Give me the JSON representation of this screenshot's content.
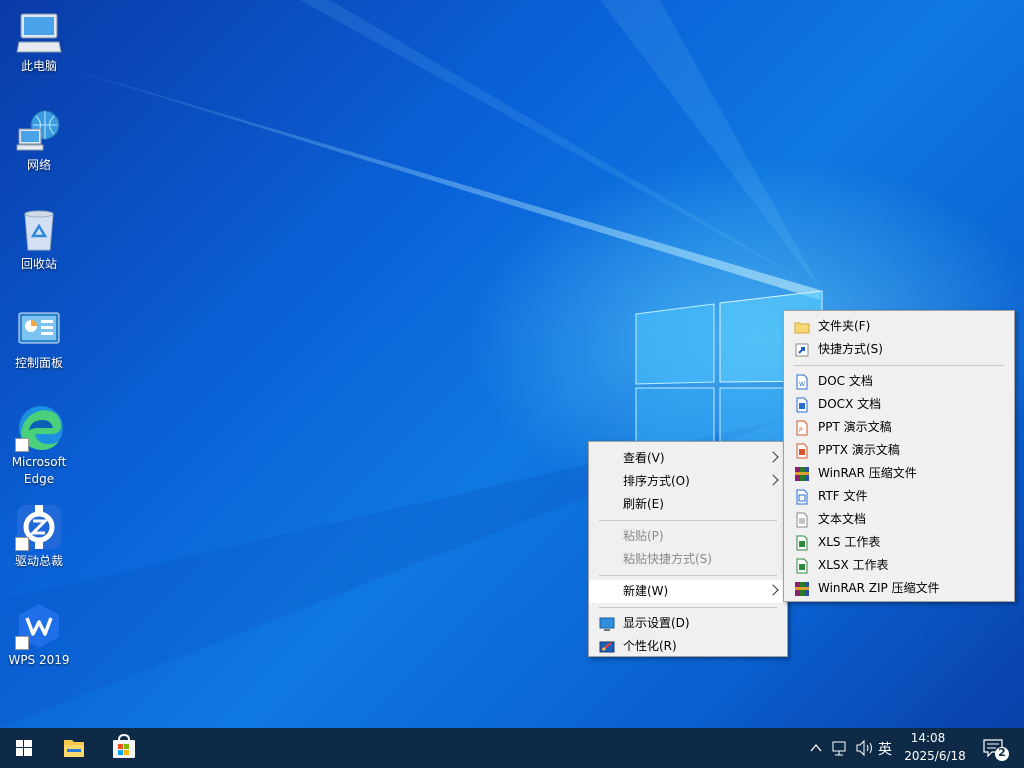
{
  "desktop": {
    "icons": [
      {
        "label": "此电脑",
        "icon": "computer-icon"
      },
      {
        "label": "网络",
        "icon": "network-icon"
      },
      {
        "label": "回收站",
        "icon": "recycle-bin-icon"
      },
      {
        "label": "控制面板",
        "icon": "control-panel-icon"
      },
      {
        "label": "Microsoft Edge",
        "icon": "edge-icon"
      },
      {
        "label": "驱动总裁",
        "icon": "driver-icon"
      },
      {
        "label": "WPS 2019",
        "icon": "wps-icon"
      }
    ]
  },
  "context_menu": {
    "items": [
      {
        "label": "查看(V)",
        "has_submenu": true
      },
      {
        "label": "排序方式(O)",
        "has_submenu": true
      },
      {
        "label": "刷新(E)"
      },
      {
        "label": "粘贴(P)",
        "disabled": true
      },
      {
        "label": "粘贴快捷方式(S)",
        "disabled": true
      },
      {
        "label": "新建(W)",
        "has_submenu": true,
        "highlighted": true
      },
      {
        "label": "显示设置(D)",
        "icon": "display-settings-icon"
      },
      {
        "label": "个性化(R)",
        "icon": "personalize-icon"
      }
    ]
  },
  "new_submenu": {
    "items": [
      {
        "label": "文件夹(F)",
        "icon": "folder-icon"
      },
      {
        "label": "快捷方式(S)",
        "icon": "shortcut-icon"
      },
      {
        "label": "DOC 文档",
        "icon": "doc-icon"
      },
      {
        "label": "DOCX 文档",
        "icon": "docx-icon"
      },
      {
        "label": "PPT 演示文稿",
        "icon": "ppt-icon"
      },
      {
        "label": "PPTX 演示文稿",
        "icon": "pptx-icon"
      },
      {
        "label": "WinRAR 压缩文件",
        "icon": "winrar-icon"
      },
      {
        "label": "RTF 文件",
        "icon": "rtf-icon"
      },
      {
        "label": "文本文档",
        "icon": "text-document-icon"
      },
      {
        "label": "XLS 工作表",
        "icon": "xls-icon"
      },
      {
        "label": "XLSX 工作表",
        "icon": "xlsx-icon"
      },
      {
        "label": "WinRAR ZIP 压缩文件",
        "icon": "winrar-zip-icon"
      }
    ]
  },
  "taskbar": {
    "ime": "英",
    "time": "14:08",
    "date": "2025/6/18",
    "notification_count": "2"
  },
  "colors": {
    "taskbar": "#0f2a47",
    "menu_bg": "#f0f0f0",
    "accent": "#0078d7"
  }
}
